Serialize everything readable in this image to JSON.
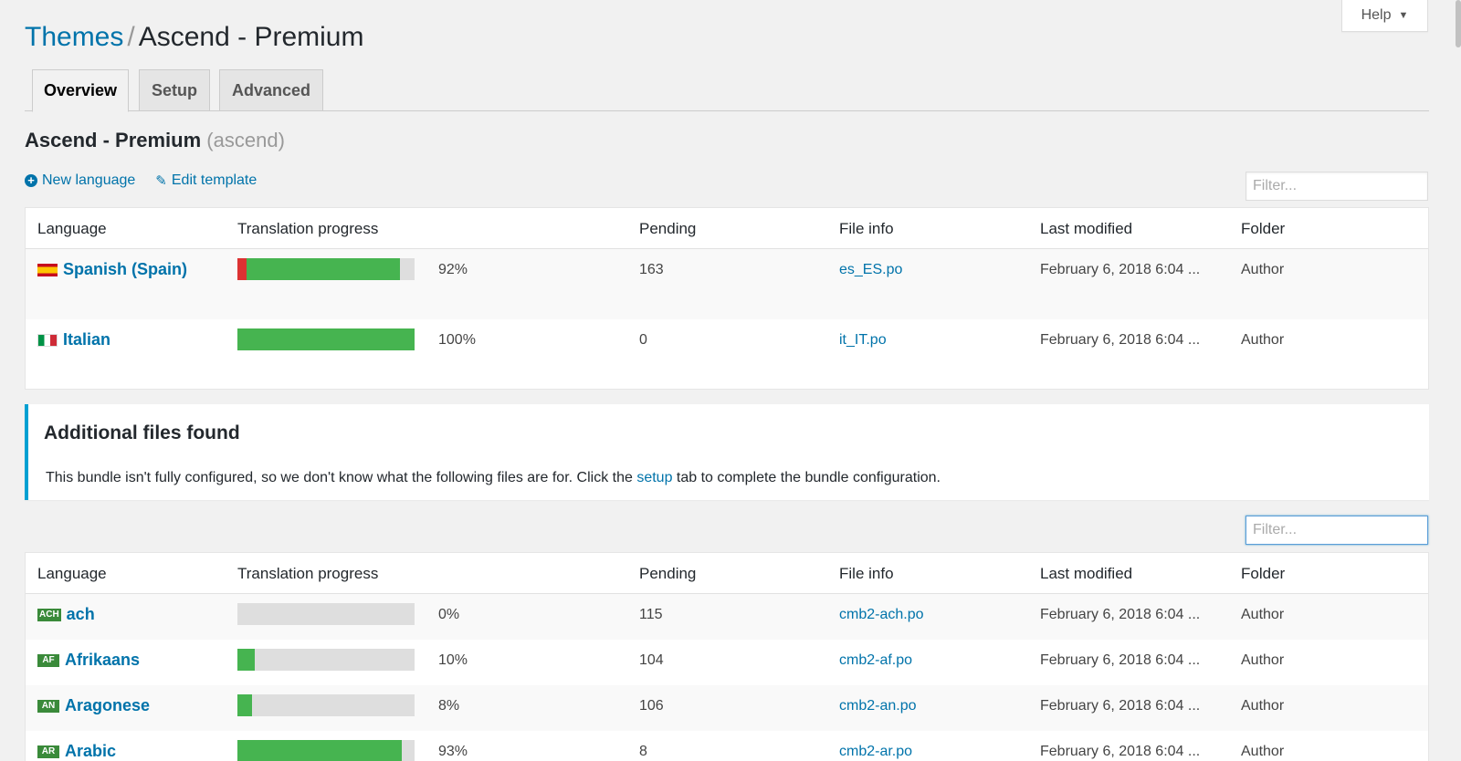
{
  "header": {
    "help_label": "Help",
    "breadcrumb_root": "Themes",
    "breadcrumb_sep": "/",
    "page_title": "Ascend - Premium"
  },
  "tabs": [
    {
      "label": "Overview",
      "active": true
    },
    {
      "label": "Setup",
      "active": false
    },
    {
      "label": "Advanced",
      "active": false
    }
  ],
  "bundle": {
    "name": "Ascend - Premium",
    "slug": "(ascend)"
  },
  "actions": {
    "new_language": "New language",
    "edit_template": "Edit template"
  },
  "filter_placeholder": "Filter...",
  "columns": [
    "Language",
    "Translation progress",
    "Pending",
    "File info",
    "Last modified",
    "Folder"
  ],
  "configured": [
    {
      "language": "Spanish (Spain)",
      "flag": "es",
      "progress": 92,
      "untranslated": 5,
      "pct": "92%",
      "pending": "163",
      "file": "es_ES.po",
      "modified": "February 6, 2018 6:04 ...",
      "folder": "Author"
    },
    {
      "language": "Italian",
      "flag": "it",
      "progress": 100,
      "untranslated": 0,
      "pct": "100%",
      "pending": "0",
      "file": "it_IT.po",
      "modified": "February 6, 2018 6:04 ...",
      "folder": "Author"
    }
  ],
  "notice": {
    "title": "Additional files found",
    "text_before": "This bundle isn't fully configured, so we don't know what the following files are for. Click the ",
    "link": "setup",
    "text_after": " tab to complete the bundle configuration."
  },
  "additional": [
    {
      "language": "ach",
      "code": "ACH",
      "progress": 0,
      "pct": "0%",
      "pending": "115",
      "file": "cmb2-ach.po",
      "modified": "February 6, 2018 6:04 ...",
      "folder": "Author"
    },
    {
      "language": "Afrikaans",
      "code": "AF",
      "progress": 10,
      "pct": "10%",
      "pending": "104",
      "file": "cmb2-af.po",
      "modified": "February 6, 2018 6:04 ...",
      "folder": "Author"
    },
    {
      "language": "Aragonese",
      "code": "AN",
      "progress": 8,
      "pct": "8%",
      "pending": "106",
      "file": "cmb2-an.po",
      "modified": "February 6, 2018 6:04 ...",
      "folder": "Author"
    },
    {
      "language": "Arabic",
      "code": "AR",
      "progress": 93,
      "pct": "93%",
      "pending": "8",
      "file": "cmb2-ar.po",
      "modified": "February 6, 2018 6:04 ...",
      "folder": "Author"
    }
  ],
  "colors": {
    "accent": "#0073aa",
    "progress_green": "#46b450",
    "progress_red": "#dc3232",
    "notice_border": "#00a0d2"
  }
}
